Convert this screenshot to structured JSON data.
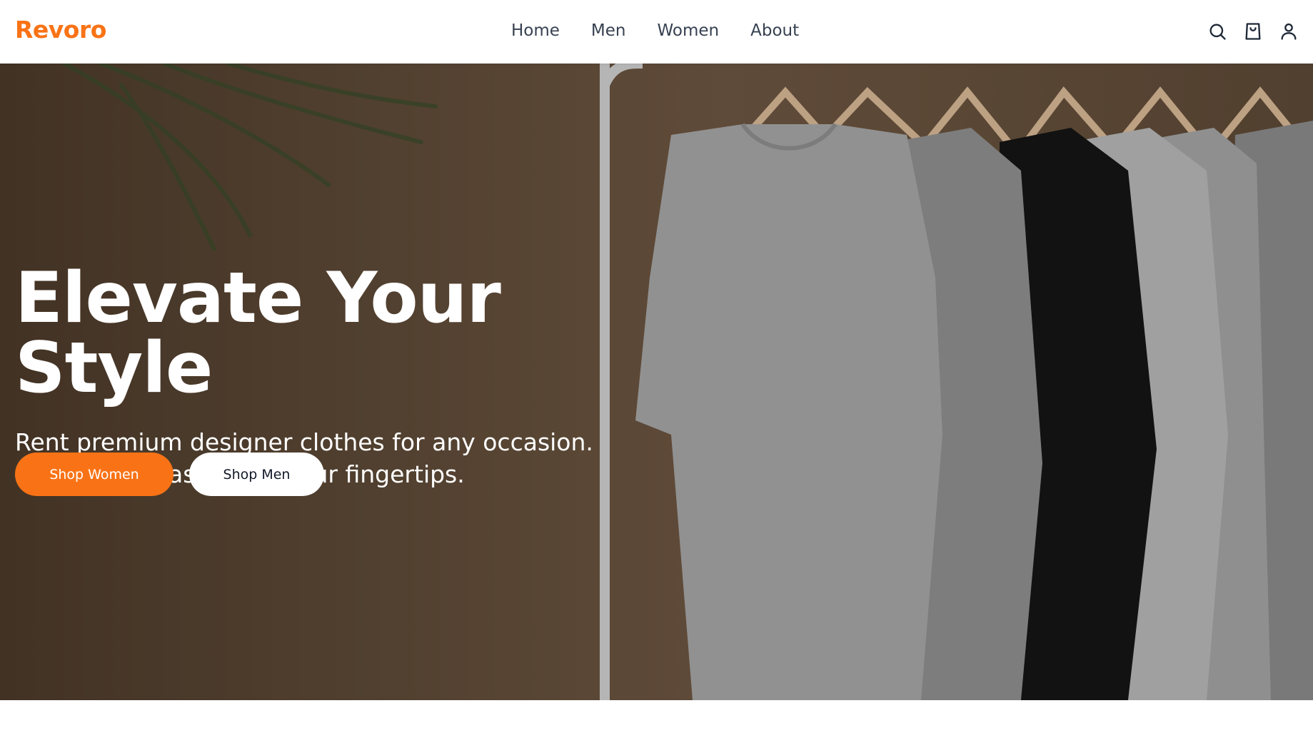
{
  "brand": {
    "name": "Revoro",
    "accent_color": "#f97316"
  },
  "nav": {
    "items": [
      "Home",
      "Men",
      "Women",
      "About"
    ]
  },
  "header_icons": [
    "search-icon",
    "cart-icon",
    "user-icon"
  ],
  "hero": {
    "title": "Elevate Your Style",
    "subtitle": "Rent premium designer clothes for any occasion. Sustainable fashion at your fingertips.",
    "primary_button": "Shop Women",
    "secondary_button": "Shop Men",
    "image": "clothing rack with t-shirts on wooden hangers"
  }
}
